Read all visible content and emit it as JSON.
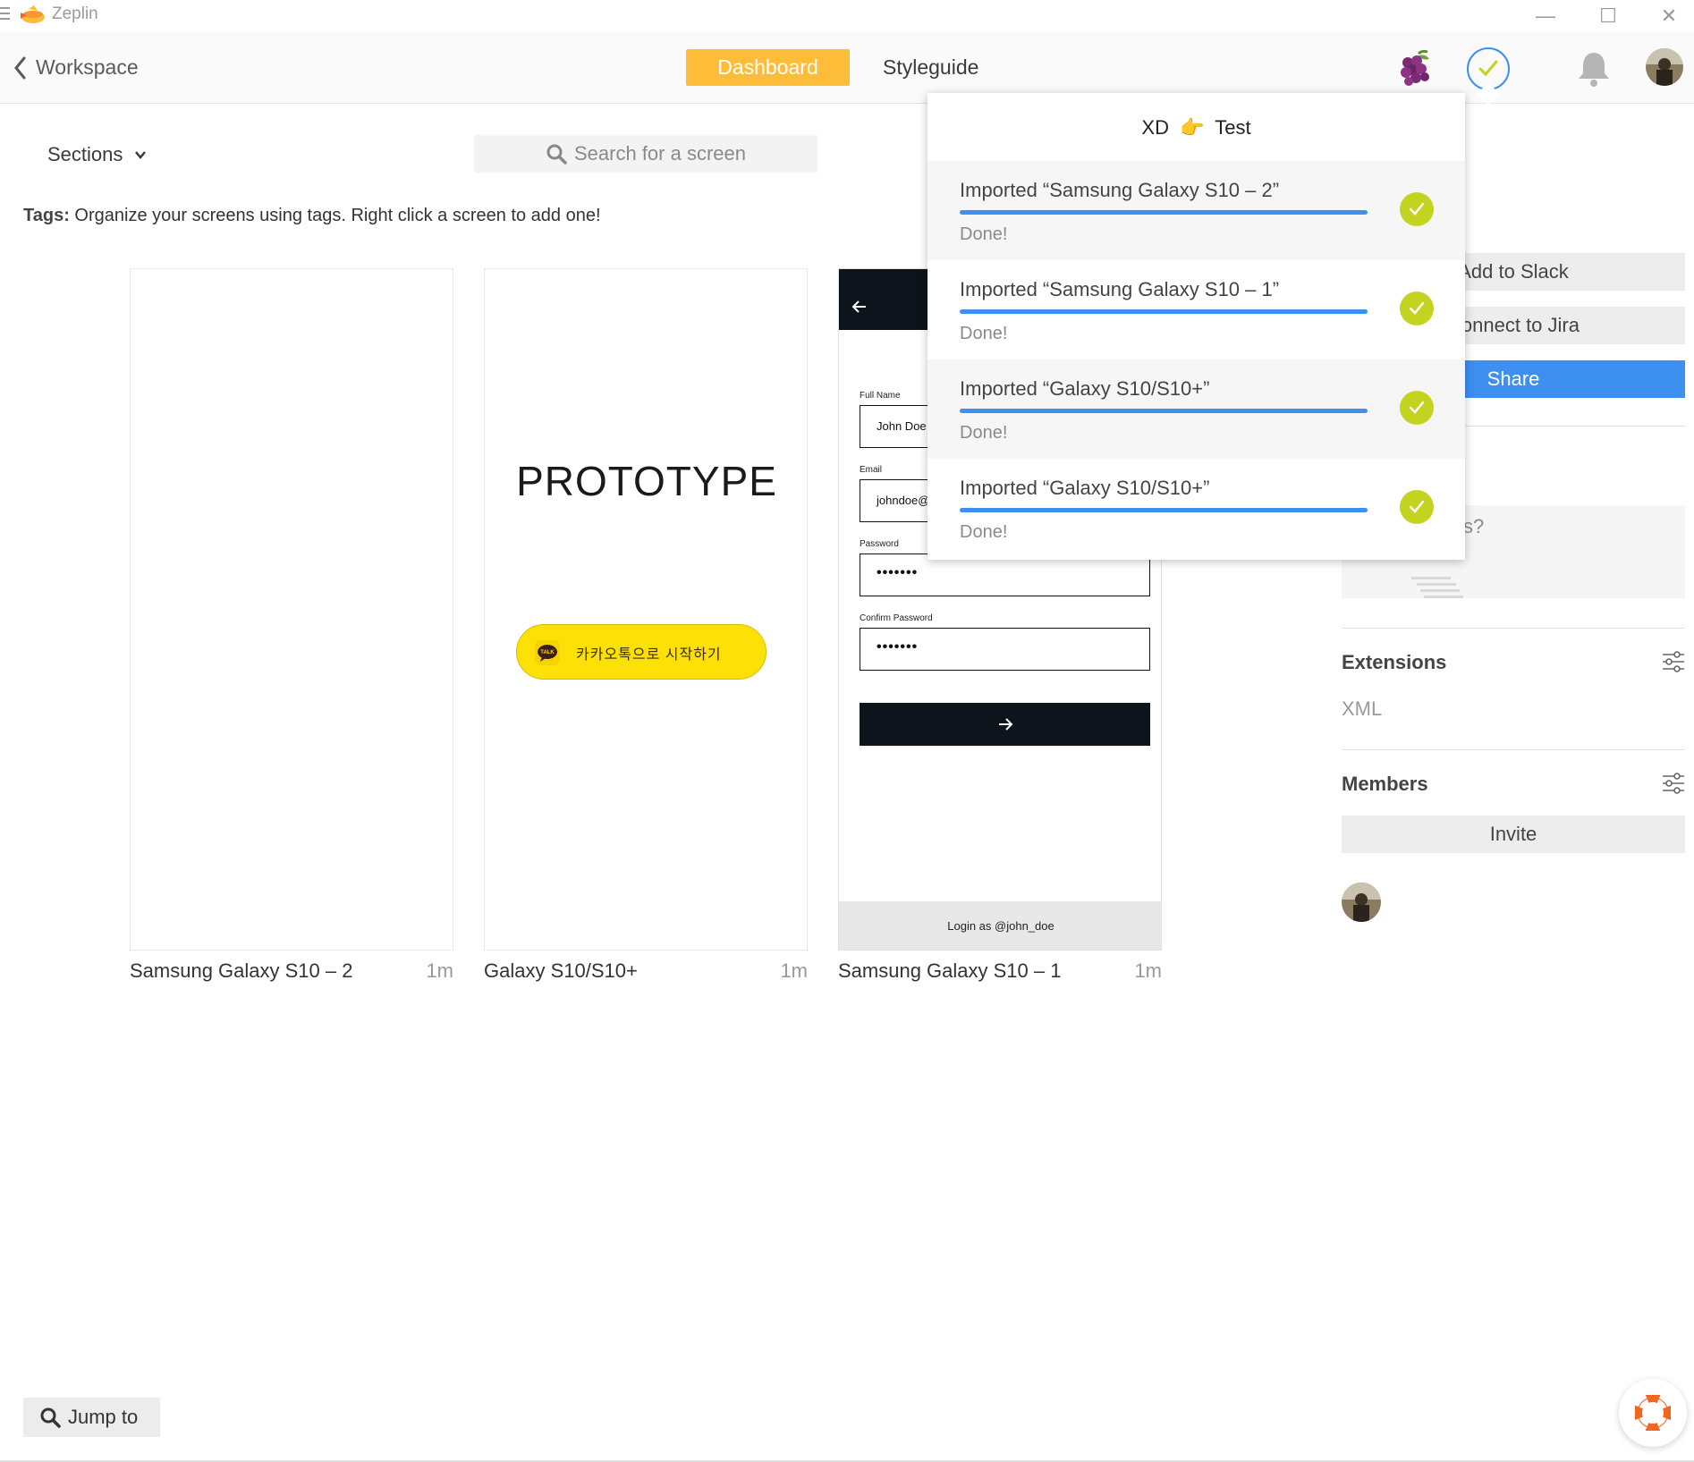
{
  "window": {
    "title": "Zeplin",
    "minimize": "—",
    "maximize": "☐",
    "close": "✕"
  },
  "header": {
    "back_label": "Workspace",
    "tabs": [
      {
        "label": "Dashboard",
        "active": true
      },
      {
        "label": "Styleguide",
        "active": false
      }
    ],
    "accent_color": "#fdbd39",
    "icons": [
      "grapes-icon",
      "activity-check-icon",
      "bell-icon",
      "user-avatar"
    ]
  },
  "toolbar": {
    "sections_label": "Sections",
    "search_placeholder": "Search for a screen"
  },
  "tags": {
    "label": "Tags:",
    "text": "Organize your screens using tags. Right click a screen to add one!"
  },
  "screens": [
    {
      "name": "Samsung Galaxy S10 – 2",
      "time": "1m"
    },
    {
      "name": "Galaxy S10/S10+",
      "time": "1m",
      "preview_title": "PROTOTYPE",
      "button_label": "카카오톡으로 시작하기",
      "button_icon": "TALK"
    },
    {
      "name": "Samsung Galaxy S10 – 1",
      "time": "1m",
      "form": {
        "fields": [
          {
            "label": "Full Name",
            "value": "John Doe"
          },
          {
            "label": "Email",
            "value": "johndoe@"
          },
          {
            "label": "Password",
            "value": "•••••••"
          },
          {
            "label": "Confirm Password",
            "value": "•••••••"
          }
        ],
        "footer": "Login as @john_doe"
      }
    }
  ],
  "panel": {
    "add_slack": "Add to Slack",
    "connect_jira": "Connect to Jira",
    "share": "Share",
    "box_text": "s?",
    "extensions_title": "Extensions",
    "extensions_items": [
      "XML"
    ],
    "members_title": "Members",
    "invite": "Invite",
    "share_color": "#3d8ff0"
  },
  "activity": {
    "title_left": "XD",
    "title_emoji": "👉",
    "title_right": "Test",
    "items": [
      {
        "label": "Imported “Samsung Galaxy S10 – 2”",
        "status": "Done!",
        "progress": 1.0
      },
      {
        "label": "Imported “Samsung Galaxy S10 – 1”",
        "status": "Done!",
        "progress": 1.0
      },
      {
        "label": "Imported “Galaxy S10/S10+”",
        "status": "Done!",
        "progress": 1.0
      },
      {
        "label": "Imported “Galaxy S10/S10+”",
        "status": "Done!",
        "progress": 1.0
      }
    ],
    "check_color": "#c3d320",
    "bar_color": "#3d8ff0"
  },
  "bottom": {
    "jump_label": "Jump to"
  }
}
